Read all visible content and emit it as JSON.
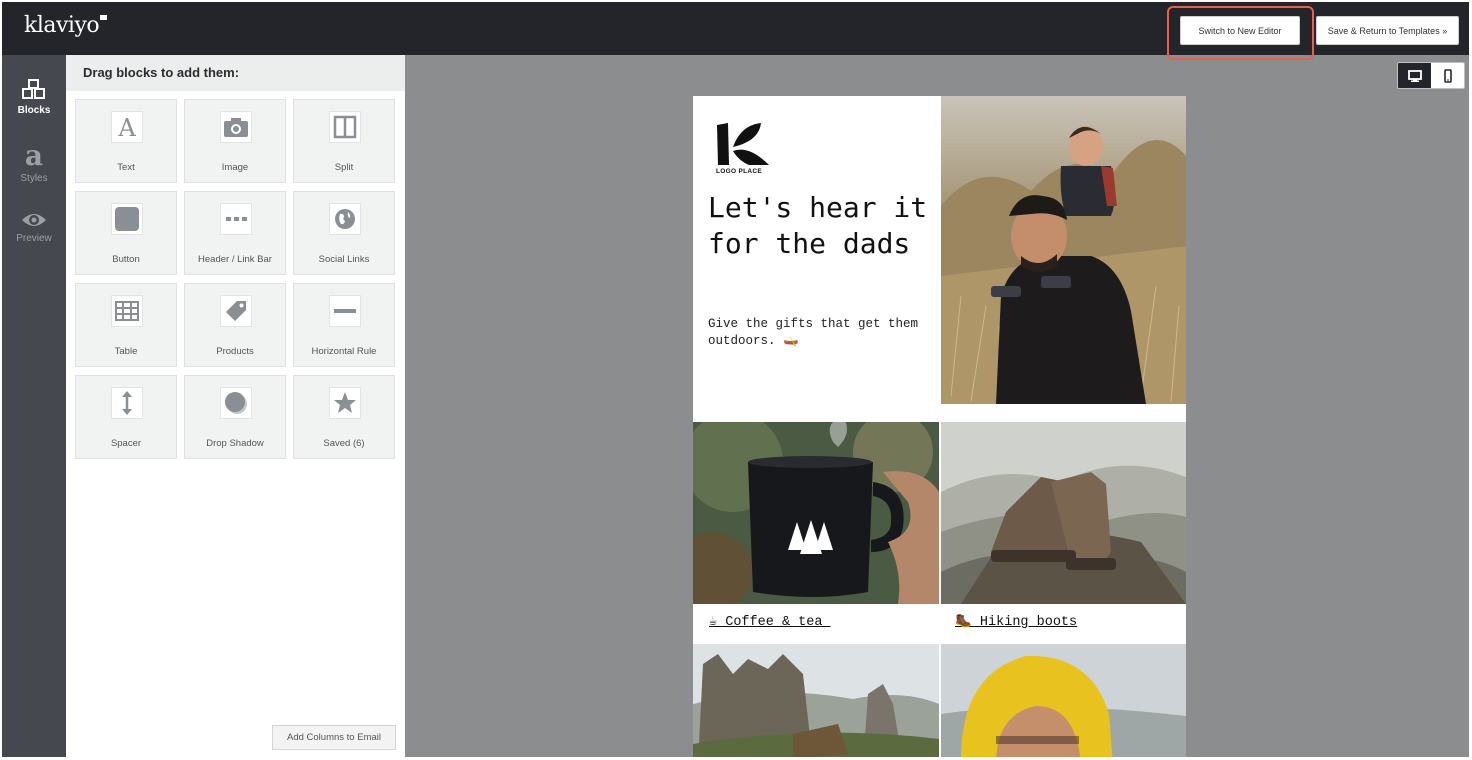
{
  "topbar": {
    "logo": "klaviyo",
    "switch_button": "Switch to New Editor",
    "save_button": "Save & Return to Templates »"
  },
  "rail": {
    "blocks": "Blocks",
    "styles": "Styles",
    "preview": "Preview"
  },
  "panel": {
    "header": "Drag blocks to add them:",
    "blocks": [
      {
        "label": "Text",
        "icon": "text-icon"
      },
      {
        "label": "Image",
        "icon": "camera-icon"
      },
      {
        "label": "Split",
        "icon": "split-icon"
      },
      {
        "label": "Button",
        "icon": "button-icon"
      },
      {
        "label": "Header / Link Bar",
        "icon": "link-bar-icon"
      },
      {
        "label": "Social Links",
        "icon": "globe-icon"
      },
      {
        "label": "Table",
        "icon": "table-icon"
      },
      {
        "label": "Products",
        "icon": "tag-icon"
      },
      {
        "label": "Horizontal Rule",
        "icon": "horizontal-rule-icon"
      },
      {
        "label": "Spacer",
        "icon": "spacer-icon"
      },
      {
        "label": "Drop Shadow",
        "icon": "drop-shadow-icon"
      },
      {
        "label": "Saved (6)",
        "icon": "star-icon"
      }
    ],
    "add_columns": "Add Columns to Email"
  },
  "email": {
    "logo_caption": "LOGO PLACE",
    "headline": "Let's hear it for the dads",
    "subtext": "Give the gifts that get them outdoors. 🛶",
    "caption_coffee": "☕ Coffee & tea ",
    "caption_boots": "🥾 Hiking boots"
  },
  "colors": {
    "topbar": "#23252a",
    "rail": "#45494f",
    "canvas": "#8c8d8f",
    "highlight": "#e2614f"
  }
}
